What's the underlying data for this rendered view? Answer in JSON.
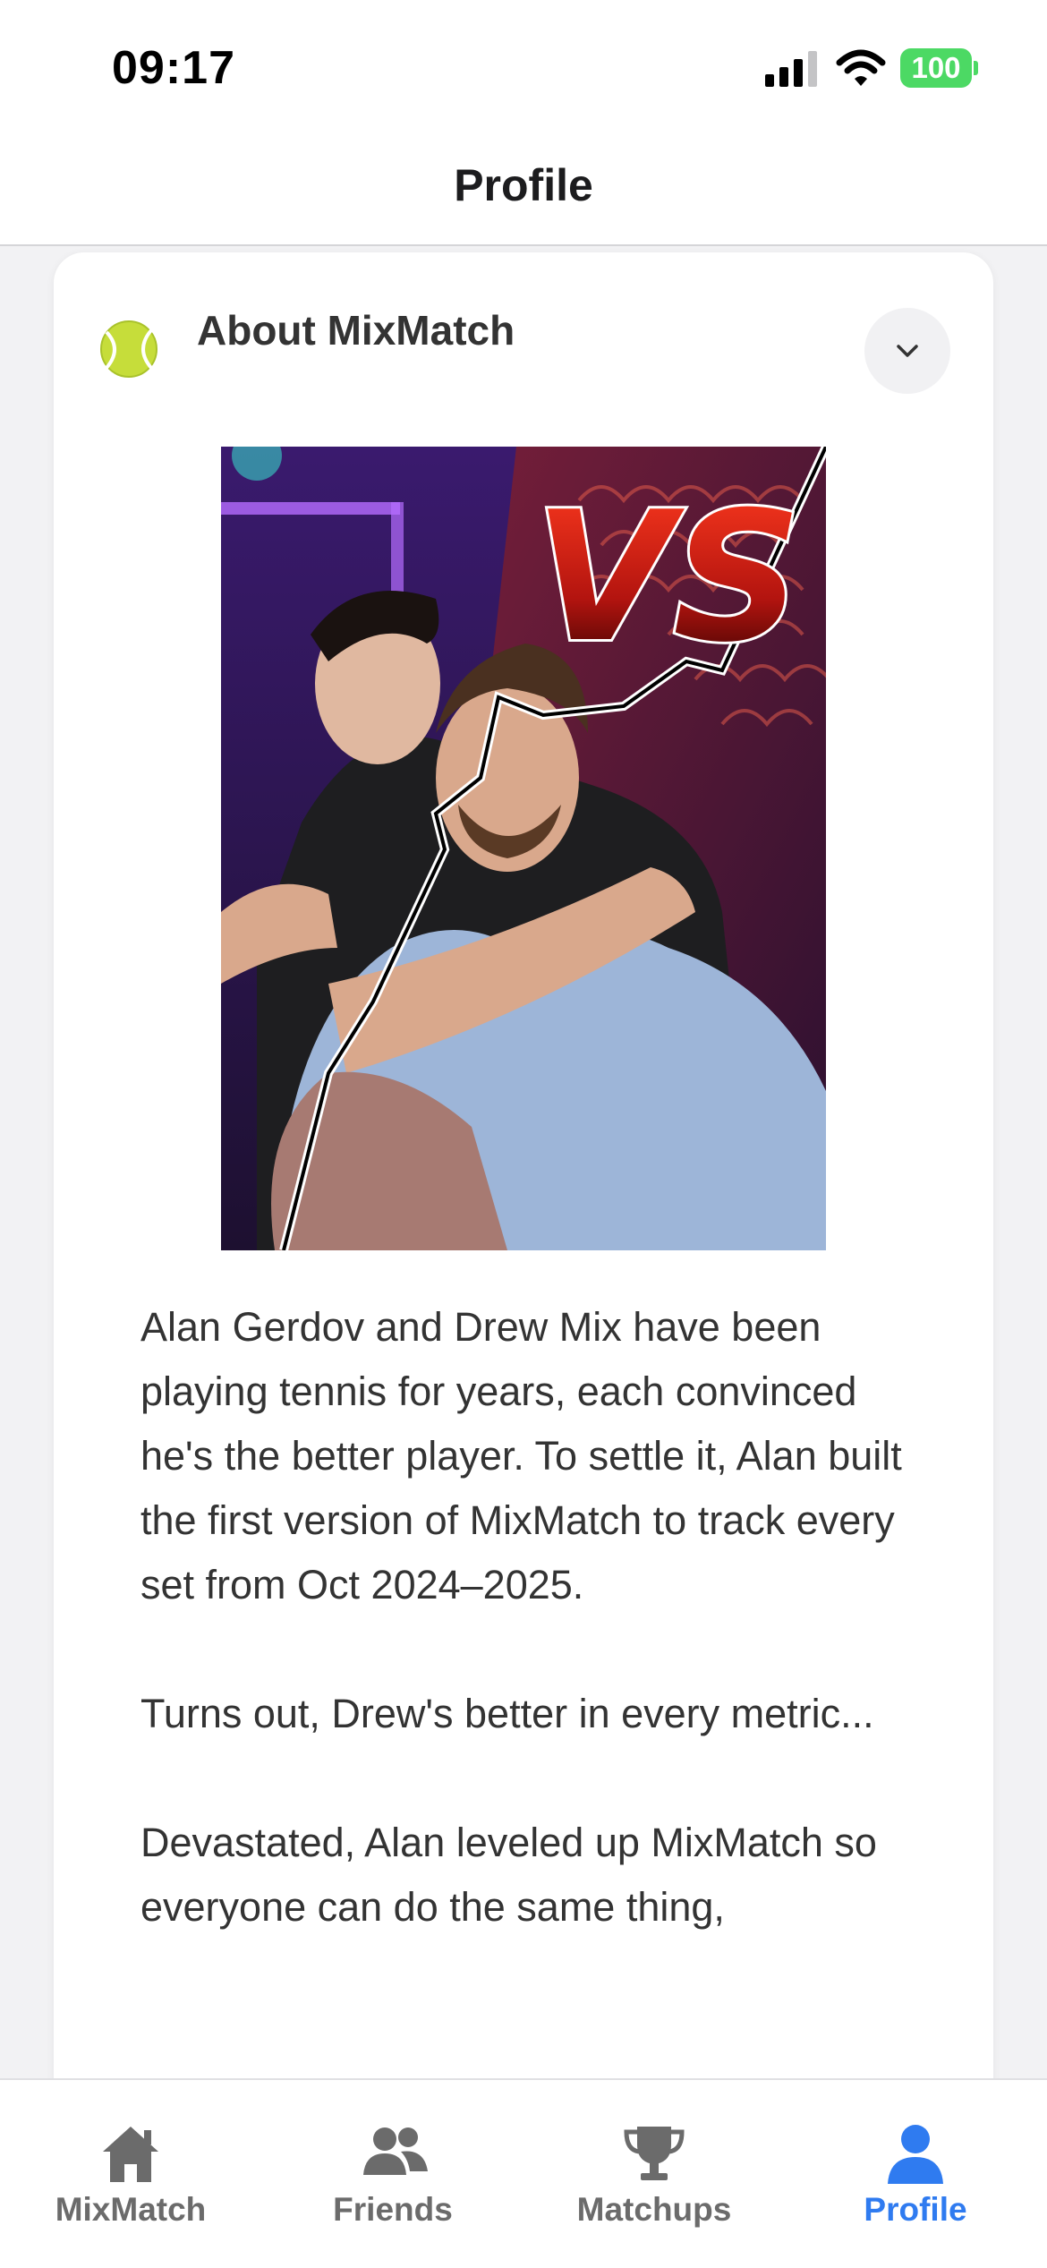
{
  "status_bar": {
    "time": "09:17",
    "battery": "100",
    "icons": [
      "signal-icon",
      "wifi-icon",
      "battery-icon"
    ]
  },
  "header": {
    "title": "Profile"
  },
  "about_card": {
    "icon": "tennis-ball-icon",
    "title": "About MixMatch",
    "toggle_icon": "chevron-down-icon",
    "image_overlay_text": "VS",
    "paragraphs": [
      "Alan Gerdov and Drew Mix have been playing tennis for years, each convinced he's the better player. To settle it, Alan built the first version of MixMatch to track every set from Oct 2024–2025.",
      "Turns out, Drew's better in every metric...",
      "Devastated, Alan leveled up MixMatch so everyone can do the same thing,"
    ]
  },
  "tab_bar": {
    "tabs": [
      {
        "label": "MixMatch",
        "icon": "home-icon",
        "active": false
      },
      {
        "label": "Friends",
        "icon": "friends-icon",
        "active": false
      },
      {
        "label": "Matchups",
        "icon": "trophy-icon",
        "active": false
      },
      {
        "label": "Profile",
        "icon": "person-icon",
        "active": true
      }
    ]
  },
  "colors": {
    "accent": "#2f7bf0",
    "inactive_tab": "#6b6b6b",
    "battery": "#4cd964",
    "background": "#f2f2f4"
  }
}
